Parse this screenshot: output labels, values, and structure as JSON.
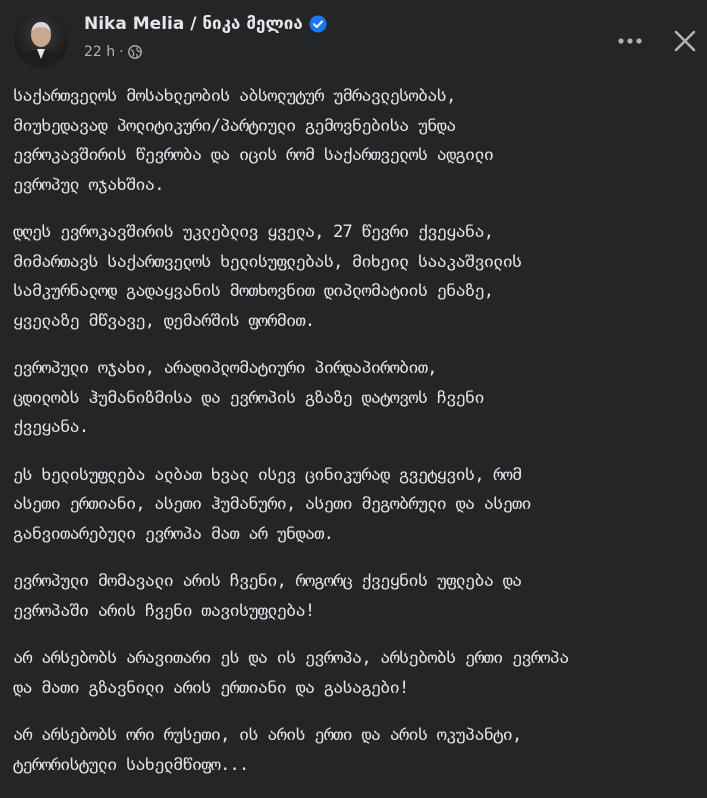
{
  "post": {
    "author": "Nika Melia / ნიკა მელია",
    "timestamp": "22 h",
    "separator": "·",
    "verified_icon": "verified-badge-icon",
    "audience_icon": "globe-icon",
    "more_icon": "more-options-icon",
    "close_icon": "close-icon",
    "colors": {
      "background": "#242526",
      "text": "#e4e6eb",
      "secondary_text": "#b0b3b8",
      "verified": "#1877f2"
    },
    "paragraphs": [
      "საქართველოს მოსახლეობის აბსოლუტურ უმრავლესობას,\nმიუხედავად პოლიტიკური/პარტიული გემოვნებისა უნდა\nევროკავშირის წევრობა და იცის რომ საქართველოს ადგილი\nევროპულ ოჯახშია.",
      "დღეს ევროკავშირის უკლებლივ ყველა, 27 წევრი ქვეყანა,\nმიმართავს საქართველოს ხელისუფლებას, მიხეილ სააკაშვილის\nსამკურნალოდ გადაყვანის მოთხოვნით დიპლომატიის ენაზე,\nყველაზე მწვავე, დემარშის ფორმით.",
      "ევროპული ოჯახი, არადიპლომატიური პირდაპირობით,\nცდილობს ჰუმანიზმისა და ევროპის გზაზე დატოვოს ჩვენი\nქვეყანა.",
      "ეს ხელისუფლება ალბათ ხვალ ისევ ცინიკურად გვეტყვის, რომ\nასეთი ერთიანი, ასეთი ჰუმანური, ასეთი მეგობრული და ასეთი\nგანვითარებული ევროპა მათ არ უნდათ.",
      "ევროპული მომავალი არის ჩვენი, როგორც ქვეყნის უფლება და\nევროპაში არის ჩვენი თავისუფლება!",
      "არ არსებობს არავითარი ეს და ის ევროპა, არსებობს ერთი ევროპა\nდა მათი გზავნილი არის ერთიანი და გასაგები!",
      "არ არსებობს ორი რუსეთი, ის არის ერთი და არის ოკუპანტი,\nტერორისტული სახელმწიფო..."
    ]
  }
}
